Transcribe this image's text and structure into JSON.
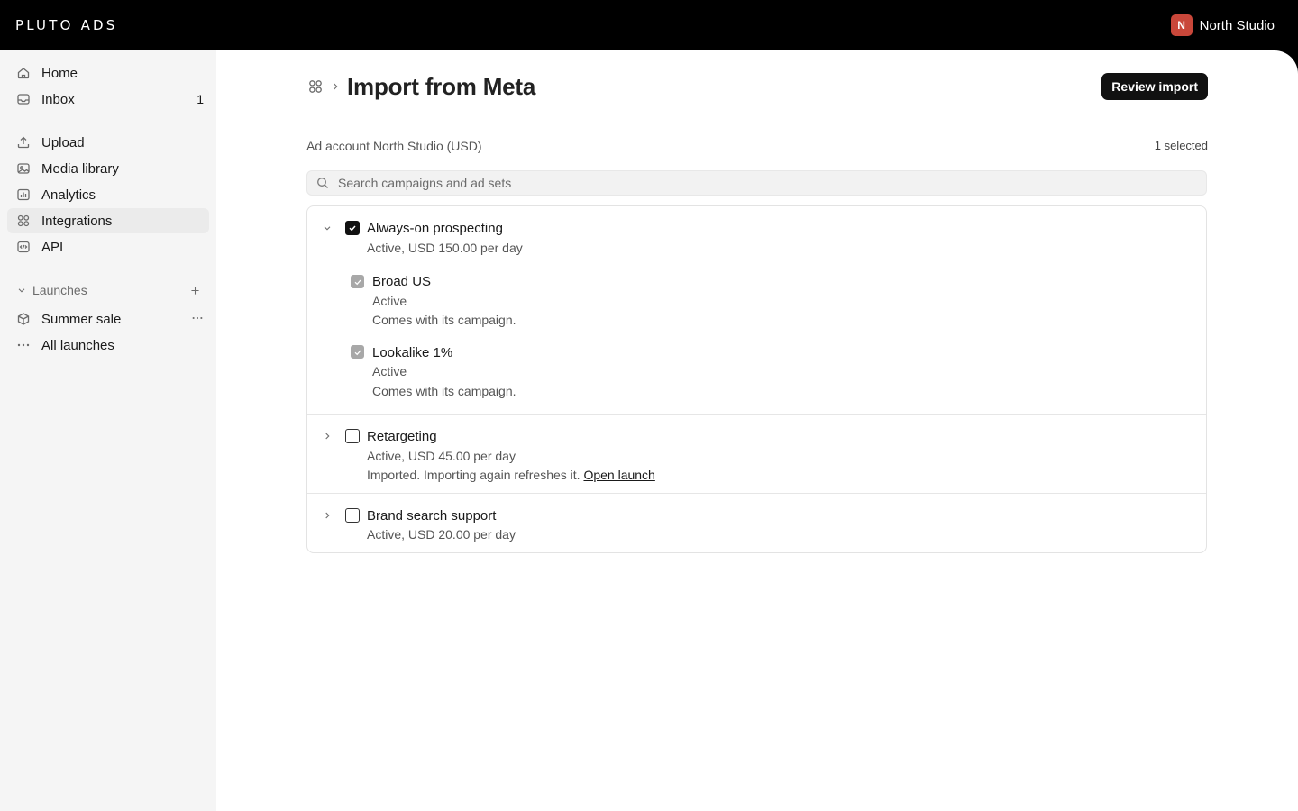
{
  "brand": {
    "logo": "PLUTO ADS"
  },
  "account": {
    "initial": "N",
    "name": "North Studio",
    "avatar_color": "#c9473a"
  },
  "sidebar": {
    "items": [
      {
        "label": "Home",
        "icon": "home-icon"
      },
      {
        "label": "Inbox",
        "icon": "inbox-icon",
        "count": "1"
      },
      {
        "label": "Upload",
        "icon": "upload-icon"
      },
      {
        "label": "Media library",
        "icon": "media-library-icon"
      },
      {
        "label": "Analytics",
        "icon": "analytics-icon"
      },
      {
        "label": "Integrations",
        "icon": "integrations-icon",
        "active": true
      },
      {
        "label": "API",
        "icon": "api-icon"
      }
    ],
    "launches_section": {
      "label": "Launches"
    },
    "launches": [
      {
        "label": "Summer sale",
        "icon": "package-icon"
      },
      {
        "label": "All launches",
        "icon": "more-horizontal-icon"
      }
    ]
  },
  "page": {
    "title": "Import from Meta",
    "review_button": "Review import",
    "ad_account": "Ad account North Studio (USD)",
    "selected_count": "1 selected",
    "search_placeholder": "Search campaigns and ad sets"
  },
  "campaigns": [
    {
      "name": "Always-on prospecting",
      "status": "Active, USD 150.00 per day",
      "checked": true,
      "expanded": true,
      "ad_sets": [
        {
          "name": "Broad US",
          "status": "Active",
          "note": "Comes with its campaign."
        },
        {
          "name": "Lookalike 1%",
          "status": "Active",
          "note": "Comes with its campaign."
        }
      ]
    },
    {
      "name": "Retargeting",
      "status": "Active, USD 45.00 per day",
      "checked": false,
      "expanded": false,
      "note": "Imported. Importing again refreshes it.",
      "link": "Open launch"
    },
    {
      "name": "Brand search support",
      "status": "Active, USD 20.00 per day",
      "checked": false,
      "expanded": false
    }
  ]
}
